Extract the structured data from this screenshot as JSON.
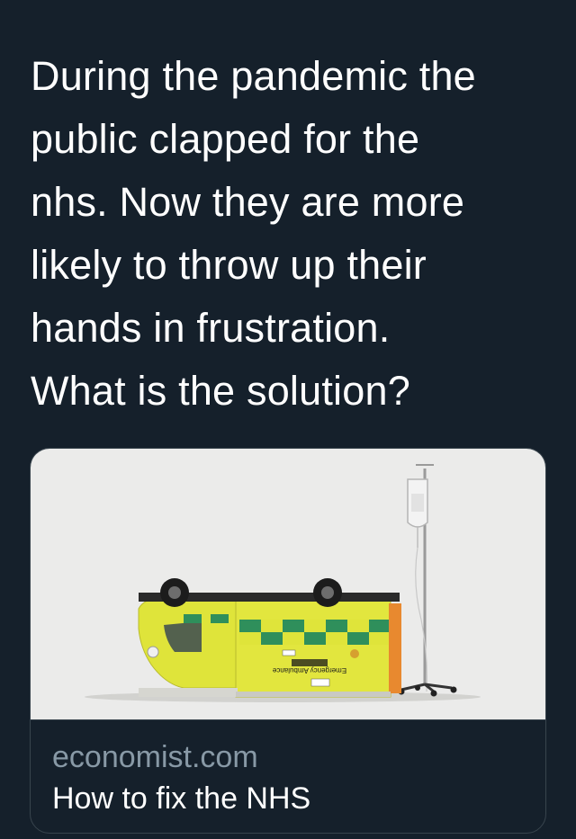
{
  "tweet": {
    "text": "During the pandemic the\npublic clapped for the\nnhs. Now they are more\nlikely to throw up their\nhands in frustration.\nWhat is the solution?"
  },
  "link_card": {
    "domain": "economist.com",
    "title": "How to fix the NHS",
    "image": {
      "alt_icon": "overturned-ambulance-illustration",
      "vehicle_text": "Emergency Ambulance",
      "colors": {
        "background": "#ebebea",
        "body_yellow": "#dfe43a",
        "battenburg_green": "#2f8f5b",
        "tire": "#1c1c1c"
      }
    }
  },
  "theme": {
    "background": "#15202b",
    "border": "#38444d",
    "text_primary": "#ffffff",
    "text_secondary": "#8899a6"
  }
}
